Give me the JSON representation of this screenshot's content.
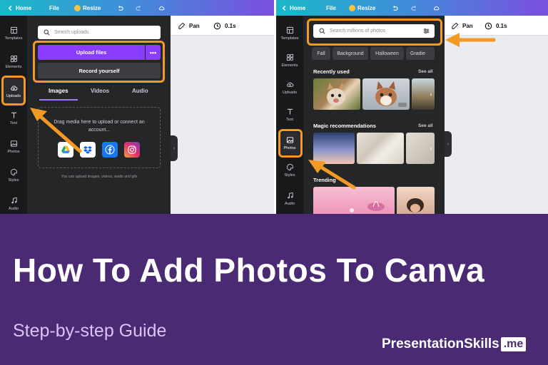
{
  "colors": {
    "accent_orange": "#f39a26",
    "canva_purple": "#8b3dff",
    "banner_purple": "#492a73",
    "subtitle_lavender": "#d9c5f5",
    "panel_dark": "#252627",
    "rail_dark": "#18191b"
  },
  "topbar": {
    "home": "Home",
    "file": "File",
    "resize": "Resize",
    "icons": [
      "chevron-left-icon",
      "crown-icon",
      "undo-icon",
      "redo-icon",
      "cloud-sync-icon"
    ]
  },
  "canvasbar": {
    "pan": "Pan",
    "duration": "0.1s"
  },
  "rail_left": {
    "templates": "Templates",
    "elements": "Elements",
    "uploads": "Uploads",
    "text": "Text",
    "photos": "Photos",
    "styles": "Styles",
    "audio": "Audio"
  },
  "rail_right": {
    "templates": "Templates",
    "elements": "Elements",
    "uploads": "Uploads",
    "text": "Text",
    "photos": "Photos",
    "styles": "Styles",
    "audio": "Audio"
  },
  "uploads_panel": {
    "search_placeholder": "Search uploads",
    "upload_files": "Upload files",
    "more": "•••",
    "record_yourself": "Record yourself",
    "tabs": [
      "Images",
      "Videos",
      "Audio"
    ],
    "drop_text": "Drag media here to upload or connect an account...",
    "services": [
      "google-drive-icon",
      "dropbox-icon",
      "facebook-icon",
      "instagram-icon"
    ],
    "hint": "You can upload images, videos, audio and gifs"
  },
  "photos_panel": {
    "search_placeholder": "Search millions of photos",
    "chips": [
      "Fall",
      "Background",
      "Halloween",
      "Gradie"
    ],
    "recently_used": "Recently used",
    "magic_recommendations": "Magic recommendations",
    "trending": "Trending",
    "see_all": "See all"
  },
  "banner": {
    "title": "How To Add Photos To Canva",
    "subtitle": "Step-by-step Guide",
    "brand": "PresentationSkills",
    "brand_tld": ".me"
  }
}
